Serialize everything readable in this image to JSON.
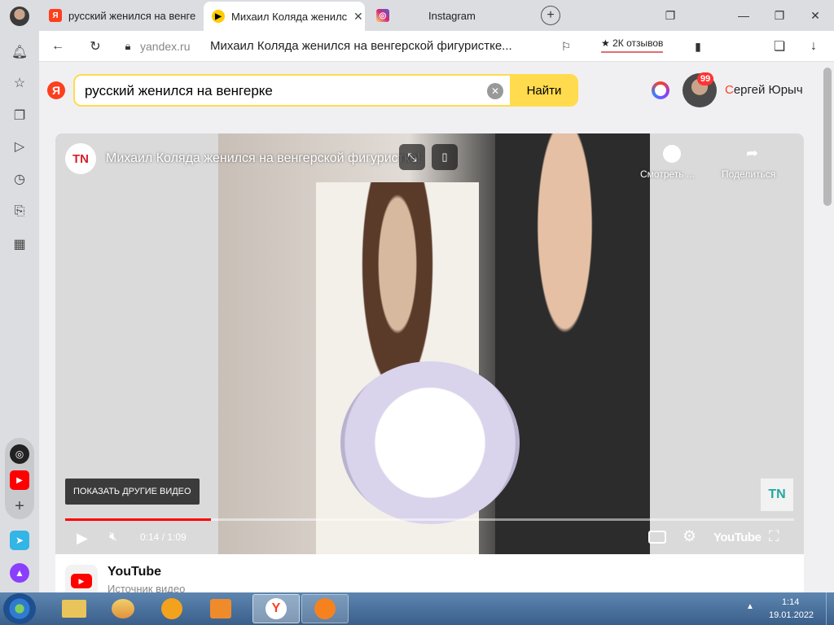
{
  "tabs": [
    {
      "title": "русский женился на венге",
      "active": false
    },
    {
      "title": "Михаил Коляда женился",
      "active": true
    },
    {
      "title": "Instagram",
      "active": false
    }
  ],
  "addressbar": {
    "domain": "yandex.ru",
    "page_title": "Михаил Коляда женился на венгерской фигуристке...",
    "reviews_label": "★ 2К отзывов"
  },
  "search": {
    "logo": "Я",
    "query": "русский женился на венгерке",
    "button_label": "Найти"
  },
  "user": {
    "name_first_letter": "С",
    "name_rest": "ергей Юрыч",
    "badge": "99"
  },
  "video": {
    "channel_logo": "TN",
    "title": "Михаил Коляда женился на венгерской фигуристке!",
    "watch_later_label": "Смотреть ...",
    "share_label": "Поделиться",
    "show_more_label": "ПОКАЗАТЬ ДРУГИЕ ВИДЕО",
    "time": "0:14 / 1:09",
    "progress": 0.2,
    "youtube_label": "YouTube",
    "watermark": "TN"
  },
  "source": {
    "name": "YouTube",
    "caption": "Источник видео"
  },
  "clock": {
    "time": "1:14",
    "date": "19.01.2022"
  },
  "colors": {
    "yandex_red": "#fc3f1d",
    "search_yellow": "#ffdb4d",
    "youtube_red": "#ff0000",
    "accent": "#ffcc00"
  }
}
